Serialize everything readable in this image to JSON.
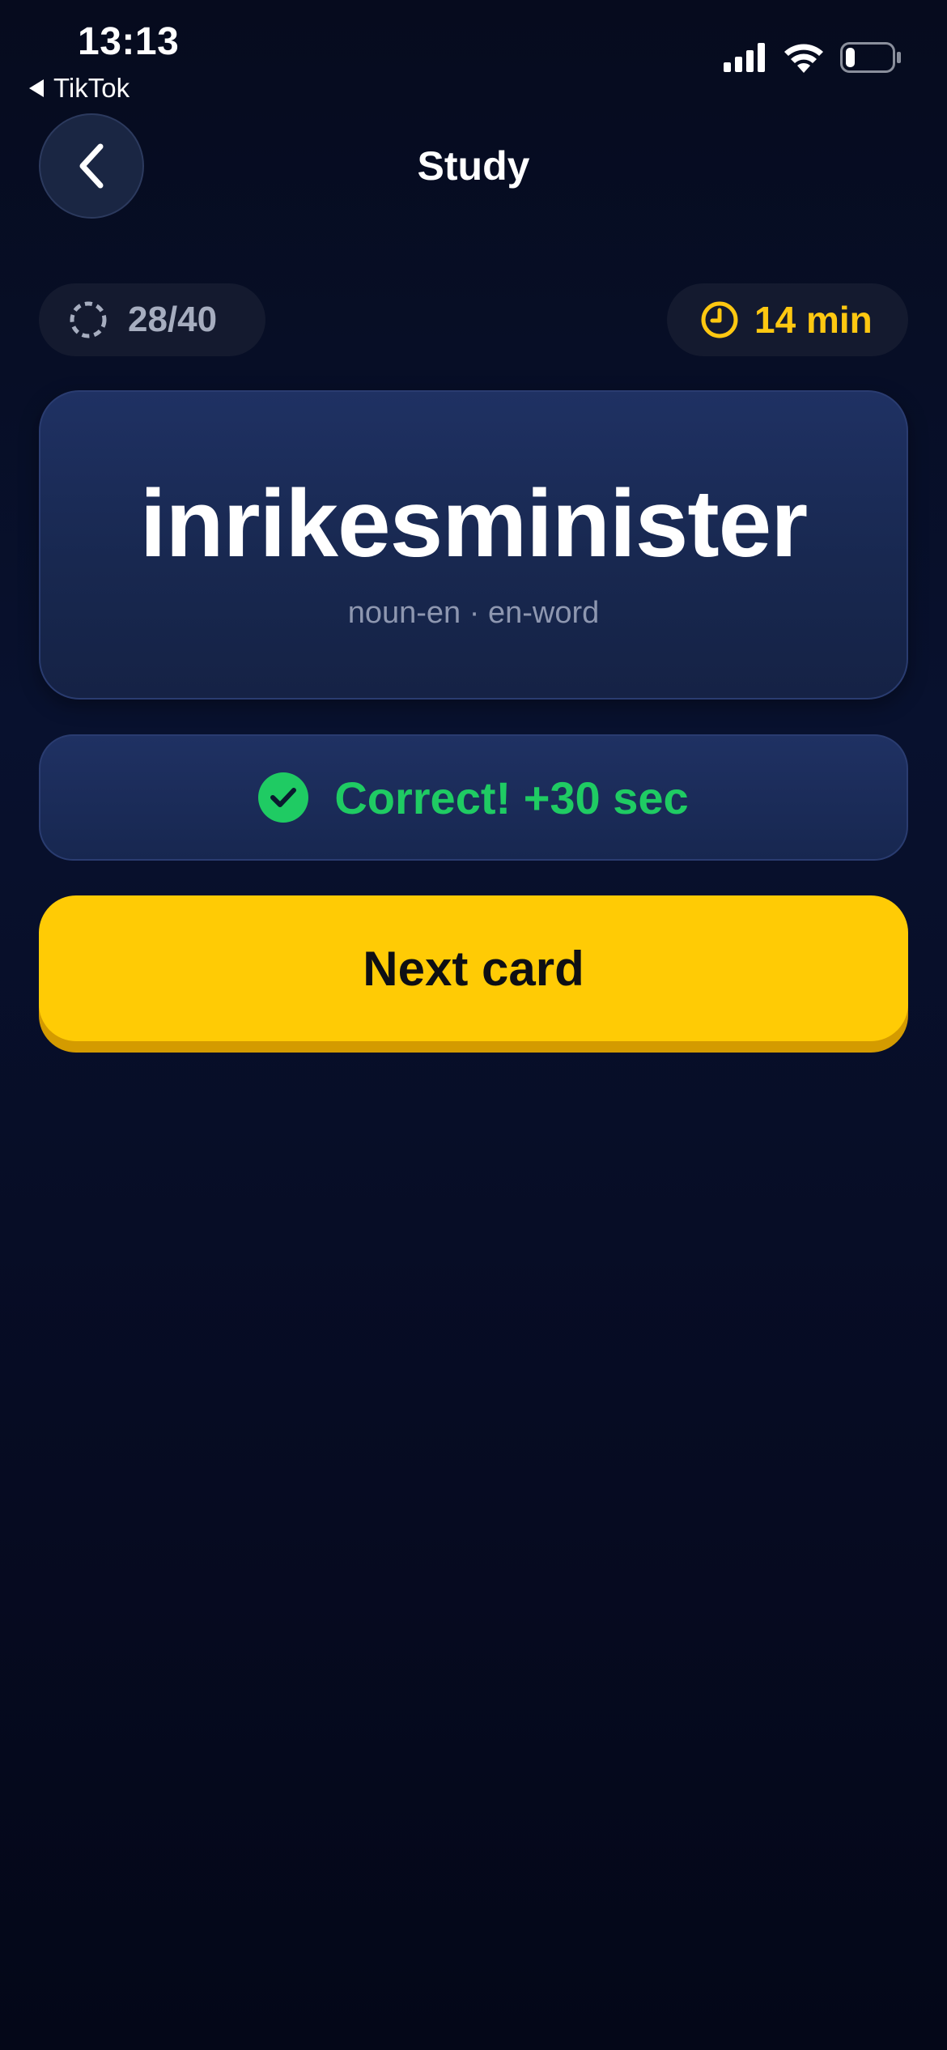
{
  "status_bar": {
    "time": "13:13",
    "back_app": "TikTok",
    "signal_icon": "cellular-signal-icon",
    "wifi_icon": "wifi-icon",
    "battery_icon": "battery-icon",
    "battery_level": 0.2
  },
  "nav": {
    "title": "Study",
    "back_icon": "chevron-left-icon"
  },
  "progress": {
    "text": "28/40",
    "current": 28,
    "total": 40,
    "icon": "dashed-circle-icon"
  },
  "timer": {
    "text": "14 min",
    "icon": "clock-icon"
  },
  "card": {
    "word": "inrikesminister",
    "meta": "noun-en · en-word"
  },
  "feedback": {
    "text": "Correct! +30 sec",
    "icon": "check-circle-icon"
  },
  "next_button": {
    "label": "Next card"
  },
  "colors": {
    "accent_yellow": "#ffcb05",
    "success_green": "#1fcb63",
    "card_blue": "#1f3163",
    "background": "#060b1e"
  }
}
